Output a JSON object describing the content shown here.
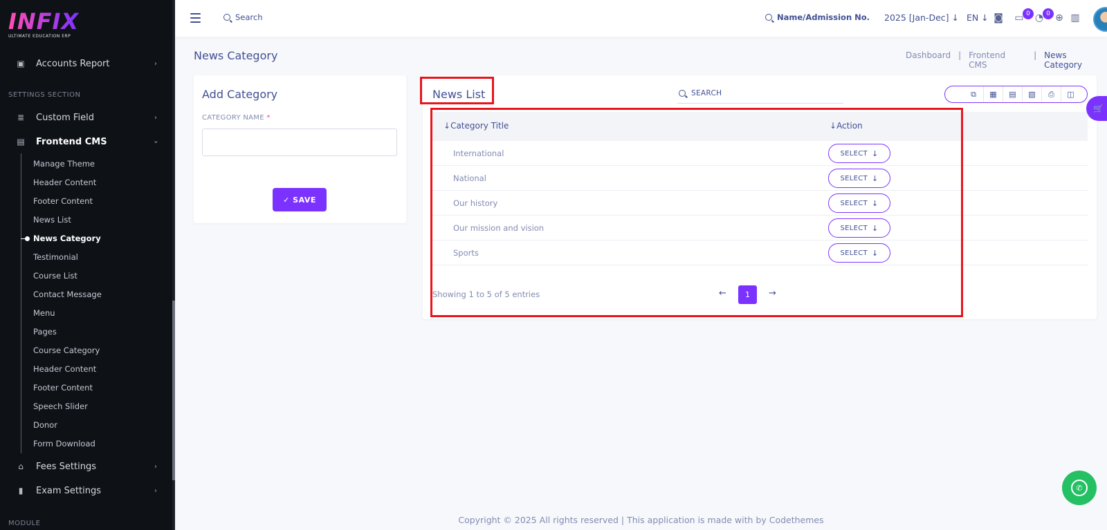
{
  "brand": {
    "name": "INFIX",
    "tagline": "ULTIMATE EDUCATION ERP"
  },
  "sidebar": {
    "accounts_report": "Accounts Report",
    "settings_section": "SETTINGS SECTION",
    "custom_field": "Custom Field",
    "frontend_cms": "Frontend CMS",
    "sub_items": [
      "Manage Theme",
      "Header Content",
      "Footer Content",
      "News List",
      "News Category",
      "Testimonial",
      "Course List",
      "Contact Message",
      "Menu",
      "Pages",
      "Course Category",
      "Header Content",
      "Footer Content",
      "Speech Slider",
      "Donor",
      "Form Download"
    ],
    "fees_settings": "Fees Settings",
    "exam_settings": "Exam Settings",
    "module_section": "MODULE"
  },
  "header": {
    "search_label": "Search",
    "admission_search": "Name/Admission No.",
    "session": "2025 [Jan-Dec]",
    "language": "EN",
    "messages_badge": "0",
    "notifications_badge": "0"
  },
  "page": {
    "title": "News Category",
    "breadcrumb": [
      "Dashboard",
      "Frontend CMS",
      "News Category"
    ]
  },
  "add_category": {
    "heading": "Add Category",
    "field_label": "CATEGORY NAME",
    "required_mark": "*",
    "field_value": "",
    "save_label": "SAVE"
  },
  "news_list": {
    "heading": "News List",
    "search_placeholder": "SEARCH",
    "columns": [
      "Category Title",
      "Action"
    ],
    "rows": [
      {
        "title": "International",
        "action": "SELECT"
      },
      {
        "title": "National",
        "action": "SELECT"
      },
      {
        "title": "Our history",
        "action": "SELECT"
      },
      {
        "title": "Our mission and vision",
        "action": "SELECT"
      },
      {
        "title": "Sports",
        "action": "SELECT"
      }
    ],
    "showing": "Showing 1 to 5 of 5 entries",
    "current_page": "1",
    "export_buttons": [
      "copy-icon",
      "excel-icon",
      "csv-icon",
      "pdf-icon",
      "print-icon",
      "columns-icon"
    ]
  },
  "footer": {
    "copyright": "Copyright © 2025 All rights reserved | This application is made with by Codethemes"
  },
  "colors": {
    "accent": "#7c32ff",
    "sidebar_bg": "#0e1217",
    "text": "#415094",
    "highlight": "#e8141c",
    "whatsapp": "#25c064"
  }
}
